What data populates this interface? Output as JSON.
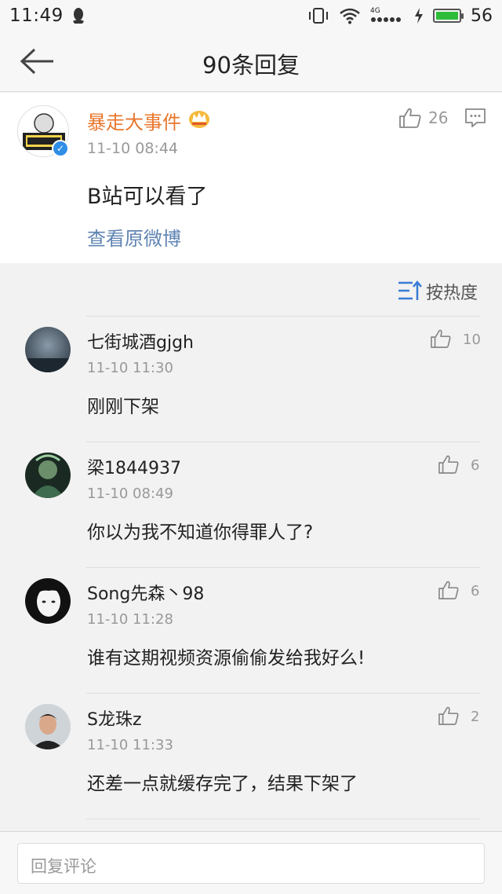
{
  "status": {
    "time": "11:49",
    "net_type": "4G",
    "battery_level": "56"
  },
  "header": {
    "title": "90条回复"
  },
  "post": {
    "author": "暴走大事件",
    "time": "11-10 08:44",
    "text": "B站可以看了",
    "link": "查看原微博",
    "likes": "26",
    "avatar_text": "暴走大事件"
  },
  "sort": {
    "label": "按热度"
  },
  "comments": [
    {
      "name": "七街城酒gjgh",
      "time": "11-10 11:30",
      "text": "刚刚下架",
      "likes": "10"
    },
    {
      "name": "梁1844937",
      "time": "11-10 08:49",
      "text": "你以为我不知道你得罪人了?",
      "likes": "6"
    },
    {
      "name": "Song先森丶98",
      "time": "11-10 11:28",
      "text": "谁有这期视频资源偷偷发给我好么!",
      "likes": "6"
    },
    {
      "name": "S龙珠z",
      "time": "11-10 11:33",
      "text": "还差一点就缓存完了，结果下架了",
      "likes": "2"
    }
  ],
  "reply": {
    "placeholder": "回复评论"
  },
  "colors": {
    "author": "#e8762c",
    "link": "#5f84b3",
    "sort_icon": "#3a7bd5",
    "verified": "#2f8ee6"
  }
}
